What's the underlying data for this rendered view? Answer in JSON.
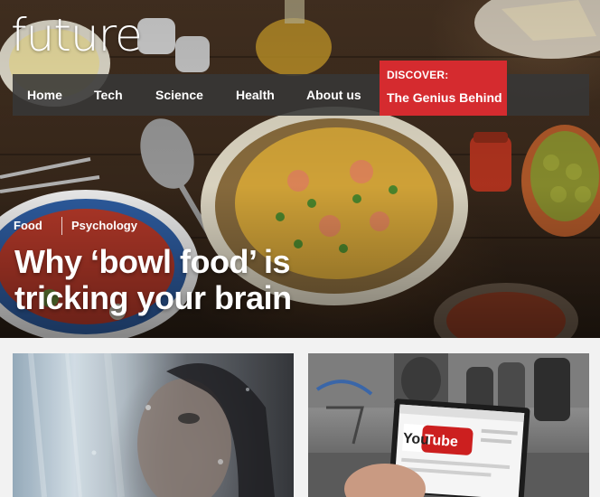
{
  "site": {
    "logo_text": "future"
  },
  "nav": {
    "items": [
      {
        "label": "Home"
      },
      {
        "label": "Tech"
      },
      {
        "label": "Science"
      },
      {
        "label": "Health"
      },
      {
        "label": "About us"
      }
    ],
    "discover": {
      "label": "DISCOVER:",
      "title": "The Genius Behind"
    }
  },
  "hero": {
    "tags": [
      {
        "label": "Food"
      },
      {
        "label": "Psychology"
      }
    ],
    "headline": "Why ‘bowl food’ is tricking your brain"
  },
  "cards": {
    "right": {
      "youtube_logo_you": "You",
      "youtube_logo_tube": "Tube"
    }
  },
  "colors": {
    "accent": "#d52b2f",
    "nav_background": "#373737",
    "text_on_dark": "#ffffff"
  }
}
